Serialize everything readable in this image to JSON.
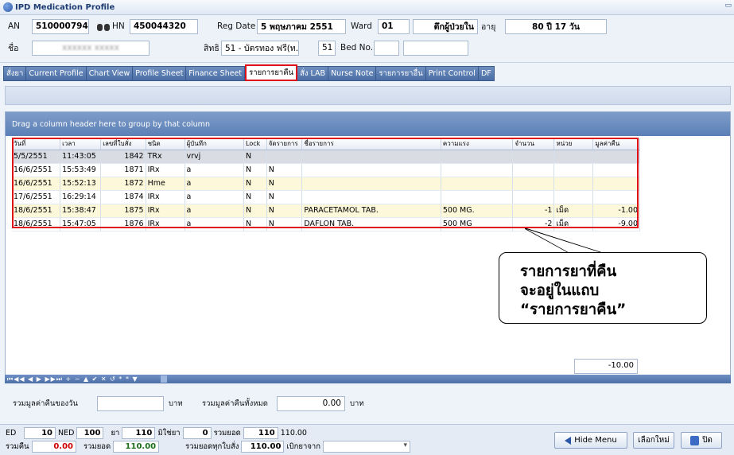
{
  "window": {
    "title": "IPD Medication Profile",
    "sys_button": "▭"
  },
  "header": {
    "an_label": "AN",
    "an_value": "510000794",
    "hn_label": "HN",
    "hn_value": "450044320",
    "regdate_label": "Reg Date",
    "regdate_value": "5 พฤษภาคม 2551",
    "ward_label": "Ward",
    "ward_code": "01",
    "ward_name": "ตึกผู้ป่วยใน",
    "age_label": "อายุ",
    "age_value": "80 ปี 17 วัน",
    "name_label": "ชื่อ",
    "name_value": "xxxxxx xxxxx",
    "right_label": "สิทธิ",
    "right_value": "51 - บัตรทอง ฟรี(ท.)",
    "right_code": "51",
    "bed_label": "Bed No.",
    "bed_value": ""
  },
  "tabs": [
    {
      "label": "สั่งยา",
      "active": false
    },
    {
      "label": "Current Profile",
      "active": false
    },
    {
      "label": "Chart View",
      "active": false
    },
    {
      "label": "Profile Sheet",
      "active": false
    },
    {
      "label": "Finance Sheet",
      "active": false
    },
    {
      "label": "รายการยาคืน",
      "active": true
    },
    {
      "label": "สั่ง LAB",
      "active": false
    },
    {
      "label": "Nurse Note",
      "active": false
    },
    {
      "label": "รายการยาอื่น",
      "active": false
    },
    {
      "label": "Print Control",
      "active": false
    },
    {
      "label": "DF",
      "active": false
    }
  ],
  "grid": {
    "group_hint": "Drag a column header here to group by that column",
    "columns": [
      "วันที่",
      "เวลา",
      "เลขที่ใบสั่ง",
      "ชนิด",
      "ผู้บันทึก",
      "Lock",
      "จัดรายการ",
      "ชื่อรายการ",
      "ความแรง",
      "จำนวน",
      "หน่วย",
      "มูลค่าคืน"
    ],
    "rows": [
      [
        "5/5/2551",
        "11:43:05",
        "1842",
        "TRx",
        "vrvj",
        "N",
        "",
        "",
        "",
        "",
        "",
        ""
      ],
      [
        "16/6/2551",
        "15:53:49",
        "1871",
        "IRx",
        "a",
        "N",
        "N",
        "",
        "",
        "",
        "",
        ""
      ],
      [
        "16/6/2551",
        "15:52:13",
        "1872",
        "Hme",
        "a",
        "N",
        "N",
        "",
        "",
        "",
        "",
        ""
      ],
      [
        "17/6/2551",
        "16:29:14",
        "1874",
        "IRx",
        "a",
        "N",
        "N",
        "",
        "",
        "",
        "",
        ""
      ],
      [
        "18/6/2551",
        "15:38:47",
        "1875",
        "IRx",
        "a",
        "N",
        "N",
        "PARACETAMOL TAB.",
        "500 MG.",
        "-1",
        "เม็ด",
        "-1.00"
      ],
      [
        "18/6/2551",
        "15:47:05",
        "1876",
        "IRx",
        "a",
        "N",
        "N",
        "DAFLON TAB.",
        "500 MG",
        "-2",
        "เม็ด",
        "-9.00"
      ]
    ],
    "total": "-10.00"
  },
  "callout": {
    "line1": "รายการยาที่คืน",
    "line2": "จะอยู่ในแถบ",
    "line3": "“รายการยาคืน”"
  },
  "navigator": {
    "buttons": "⏮◀◀ ◀ ▶ ▶▶⏭ + − ▲ ✔ ✕ ↺ * * ▼"
  },
  "summary": {
    "day_total_label": "รวมมูลค่าคืนของวัน",
    "day_total_value": "",
    "unit1": "บาท",
    "all_total_label": "รวมมูลค่าคืนทั้งหมด",
    "all_total_value": "0.00",
    "unit2": "บาท"
  },
  "bottom": {
    "ed_label": "ED",
    "ed_value": "10",
    "ned_label": "NED",
    "ned_value": "100",
    "drug_label": "ยา",
    "drug_value": "110",
    "nondrug_label": "มิใช่ยา",
    "nondrug_value": "0",
    "sum_label": "รวมยอด",
    "sum_value": "110",
    "sum_value2": "110.00",
    "return_label": "รวมคืน",
    "return_value": "0.00",
    "total_label": "รวมยอด",
    "total_value": "110.00",
    "all_orders_label": "รวมยอดทุกใบสั่ง",
    "all_orders_value": "110.00",
    "bill_label": "เบิกยาจาก",
    "bill_value": ""
  },
  "buttons": {
    "hide_menu": "Hide Menu",
    "select_new": "เลือกใหม่",
    "close": "ปิด"
  },
  "colors": {
    "highlight": "#e0101a",
    "tab_bg": "#4a6ea6",
    "alt_row": "#fdf8d9"
  }
}
